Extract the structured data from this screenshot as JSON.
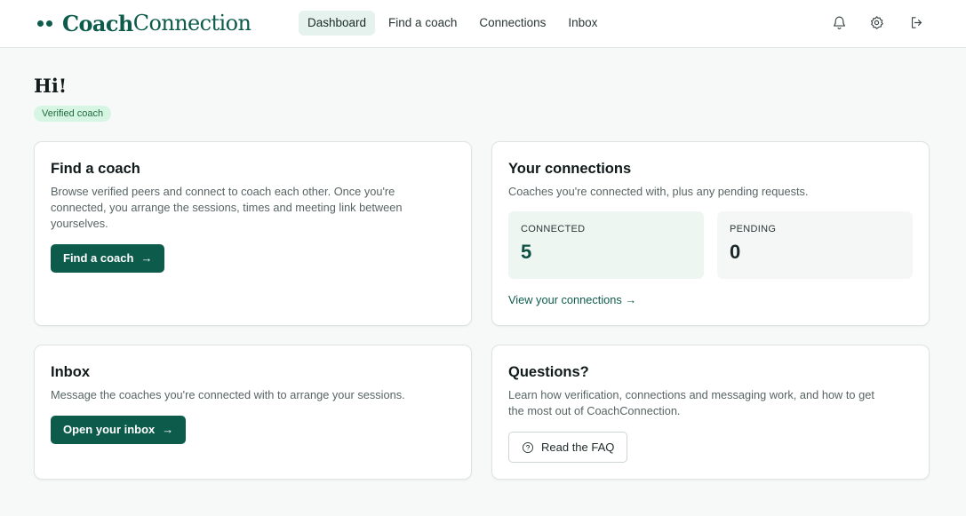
{
  "app": {
    "name_part1": "Coach",
    "name_part2": "Connection"
  },
  "nav": {
    "items": [
      {
        "label": "Dashboard",
        "active": true
      },
      {
        "label": "Find a coach",
        "active": false
      },
      {
        "label": "Connections",
        "active": false
      },
      {
        "label": "Inbox",
        "active": false
      }
    ]
  },
  "header_icons": [
    "bell-icon",
    "gear-icon",
    "logout-icon"
  ],
  "greeting": "Hi!",
  "badge": "Verified coach",
  "cards": {
    "find": {
      "title": "Find a coach",
      "desc_line1": "Browse verified peers and connect to coach each other. Once you're",
      "desc_line2": "connected, you arrange the sessions, times and meeting link between",
      "desc_line3": "yourselves.",
      "button": "Find a coach",
      "arrow": "→"
    },
    "connections": {
      "title": "Your connections",
      "desc": "Coaches you're connected with, plus any pending requests.",
      "connected_label": "CONNECTED",
      "connected_value": "5",
      "pending_label": "PENDING",
      "pending_value": "0",
      "link": "View your connections →"
    },
    "inbox": {
      "title": "Inbox",
      "desc": "Message the coaches you're connected with to arrange your sessions.",
      "button": "Open your inbox",
      "arrow": "→"
    },
    "questions": {
      "title": "Questions?",
      "desc_line1": "Learn how verification, connections and messaging work, and how to get",
      "desc_line2": "the most out of CoachConnection.",
      "button": "Read the FAQ"
    }
  },
  "colors": {
    "brand": "#0d5c4b",
    "badge_bg": "#d7f5e3",
    "nav_active_bg": "#e6f2ee"
  }
}
